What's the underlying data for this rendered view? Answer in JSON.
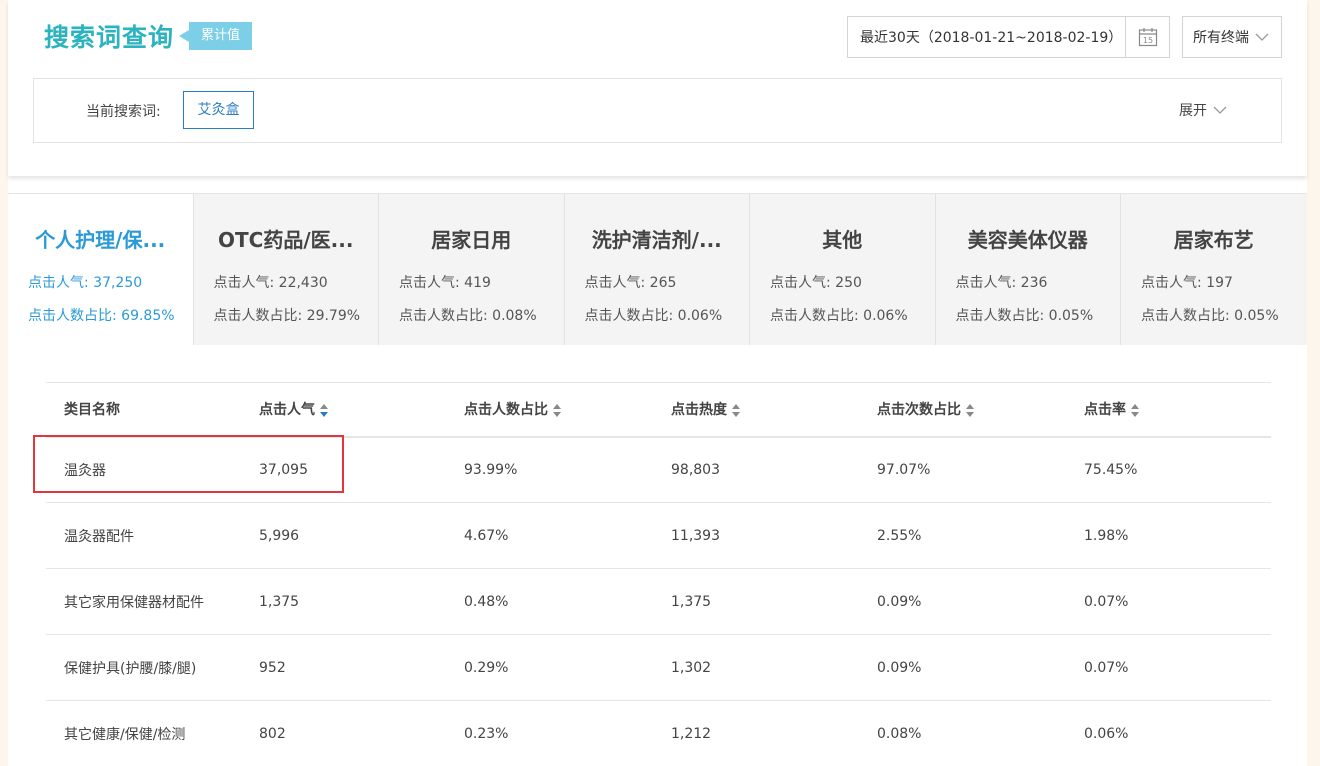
{
  "header": {
    "title": "搜索词查询",
    "badge": "累计值",
    "date_range": "最近30天（2018-01-21~2018-02-19）",
    "calendar_day": "15",
    "device": "所有终端"
  },
  "search": {
    "label": "当前搜索词:",
    "term": "艾灸盒",
    "expand": "展开"
  },
  "tabs": [
    {
      "name": "个人护理/保...",
      "stat1": "点击人气: 37,250",
      "stat2": "点击人数占比: 69.85%"
    },
    {
      "name": "OTC药品/医...",
      "stat1": "点击人气: 22,430",
      "stat2": "点击人数占比: 29.79%"
    },
    {
      "name": "居家日用",
      "stat1": "点击人气: 419",
      "stat2": "点击人数占比: 0.08%"
    },
    {
      "name": "洗护清洁剂/...",
      "stat1": "点击人气: 265",
      "stat2": "点击人数占比: 0.06%"
    },
    {
      "name": "其他",
      "stat1": "点击人气: 250",
      "stat2": "点击人数占比: 0.06%"
    },
    {
      "name": "美容美体仪器",
      "stat1": "点击人气: 236",
      "stat2": "点击人数占比: 0.05%"
    },
    {
      "name": "居家布艺",
      "stat1": "点击人气: 197",
      "stat2": "点击人数占比: 0.05%"
    }
  ],
  "table": {
    "columns": [
      "类目名称",
      "点击人气",
      "点击人数占比",
      "点击热度",
      "点击次数占比",
      "点击率"
    ],
    "rows": [
      [
        "温灸器",
        "37,095",
        "93.99%",
        "98,803",
        "97.07%",
        "75.45%"
      ],
      [
        "温灸器配件",
        "5,996",
        "4.67%",
        "11,393",
        "2.55%",
        "1.98%"
      ],
      [
        "其它家用保健器材配件",
        "1,375",
        "0.48%",
        "1,375",
        "0.09%",
        "0.07%"
      ],
      [
        "保健护具(护腰/膝/腿)",
        "952",
        "0.29%",
        "1,302",
        "0.09%",
        "0.07%"
      ],
      [
        "其它健康/保健/检测",
        "802",
        "0.23%",
        "1,212",
        "0.08%",
        "0.06%"
      ]
    ]
  },
  "colors": {
    "accent": "#2bb3c0",
    "link_blue": "#2a9ad6",
    "highlight_red": "#e3363c"
  }
}
